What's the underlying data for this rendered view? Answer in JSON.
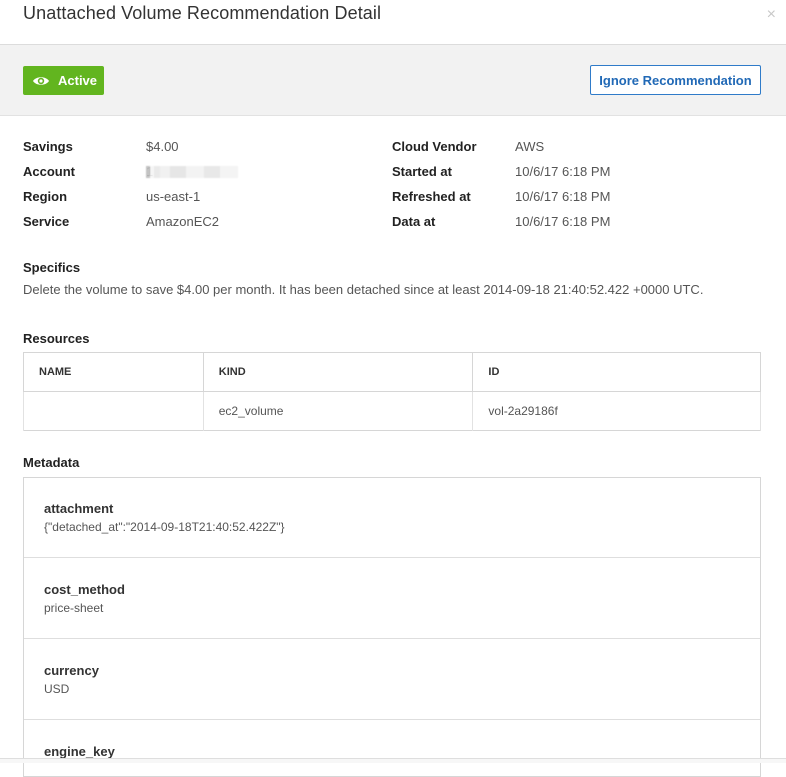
{
  "modal": {
    "title": "Unattached Volume Recommendation Detail",
    "close_symbol": "×"
  },
  "status": {
    "badge_label": "Active",
    "badge_icon": "eye-icon",
    "badge_color": "#62b51f",
    "ignore_label": "Ignore Recommendation",
    "accent_color": "#2f7bc9"
  },
  "details": {
    "left": [
      {
        "label": "Savings",
        "value": "$4.00"
      },
      {
        "label": "Account",
        "value": "1"
      },
      {
        "label": "Region",
        "value": "us-east-1"
      },
      {
        "label": "Service",
        "value": "AmazonEC2"
      }
    ],
    "right": [
      {
        "label": "Cloud Vendor",
        "value": "AWS"
      },
      {
        "label": "Started at",
        "value": "10/6/17 6:18 PM"
      },
      {
        "label": "Refreshed at",
        "value": "10/6/17 6:18 PM"
      },
      {
        "label": "Data at",
        "value": "10/6/17 6:18 PM"
      }
    ]
  },
  "specifics": {
    "title": "Specifics",
    "text": "Delete the volume to save $4.00 per month. It has been detached since at least 2014-09-18 21:40:52.422 +0000 UTC."
  },
  "resources": {
    "title": "Resources",
    "columns": [
      "NAME",
      "KIND",
      "ID"
    ],
    "rows": [
      {
        "name": "",
        "kind": "ec2_volume",
        "id": "vol-2a29186f"
      }
    ]
  },
  "metadata": {
    "title": "Metadata",
    "items": [
      {
        "key": "attachment",
        "value": "{\"detached_at\":\"2014-09-18T21:40:52.422Z\"}"
      },
      {
        "key": "cost_method",
        "value": "price-sheet"
      },
      {
        "key": "currency",
        "value": "USD"
      },
      {
        "key": "engine_key",
        "value": ""
      }
    ]
  }
}
